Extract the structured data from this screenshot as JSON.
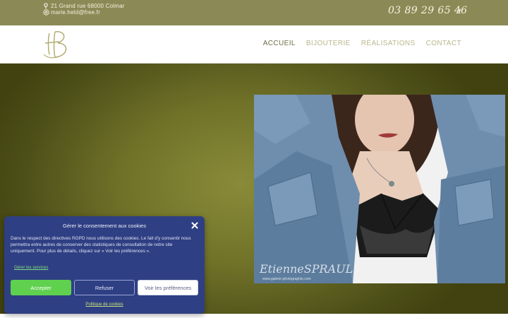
{
  "topbar": {
    "address": "21 Grand rue 68000 Colmar",
    "email": "marie.held@free.fr",
    "phone": "03 89 29 65 46",
    "facebook_icon": "facebook-icon",
    "address_icon": "map-pin-icon",
    "email_icon": "at-sign-icon"
  },
  "nav": {
    "logo_text": "HB",
    "items": [
      {
        "label": "ACCUEIL",
        "active": true
      },
      {
        "label": "BIJOUTERIE",
        "active": false
      },
      {
        "label": "RÉALISATIONS",
        "active": false
      },
      {
        "label": "CONTACT",
        "active": false
      }
    ]
  },
  "hero": {
    "photo_watermark_1": "EtienneSPRAUL",
    "photo_watermark_2": "www.galerie-photographie.com"
  },
  "cookie": {
    "title": "Gérer le consentement aux cookies",
    "text": "Dans le respect des directives RGPD nous utilisons des cookies. Le fait d'y consentir nous permettra entre autres de conserver des statistiques de consultation de notre site uniquement. Pour plus de détails, cliquez sur « Voir les préférences ».",
    "manage_link": "Gérer les services",
    "accept": "Accepter",
    "refuse": "Refuser",
    "preferences": "Voir les préférences",
    "policy_link": "Politique de cookies"
  },
  "colors": {
    "topbar": "#8b8a57",
    "nav_text": "#b9b78c",
    "hero_bg": "#6f7128",
    "cookie_bg": "#2f3f83",
    "accept_btn": "#5fd14f"
  }
}
